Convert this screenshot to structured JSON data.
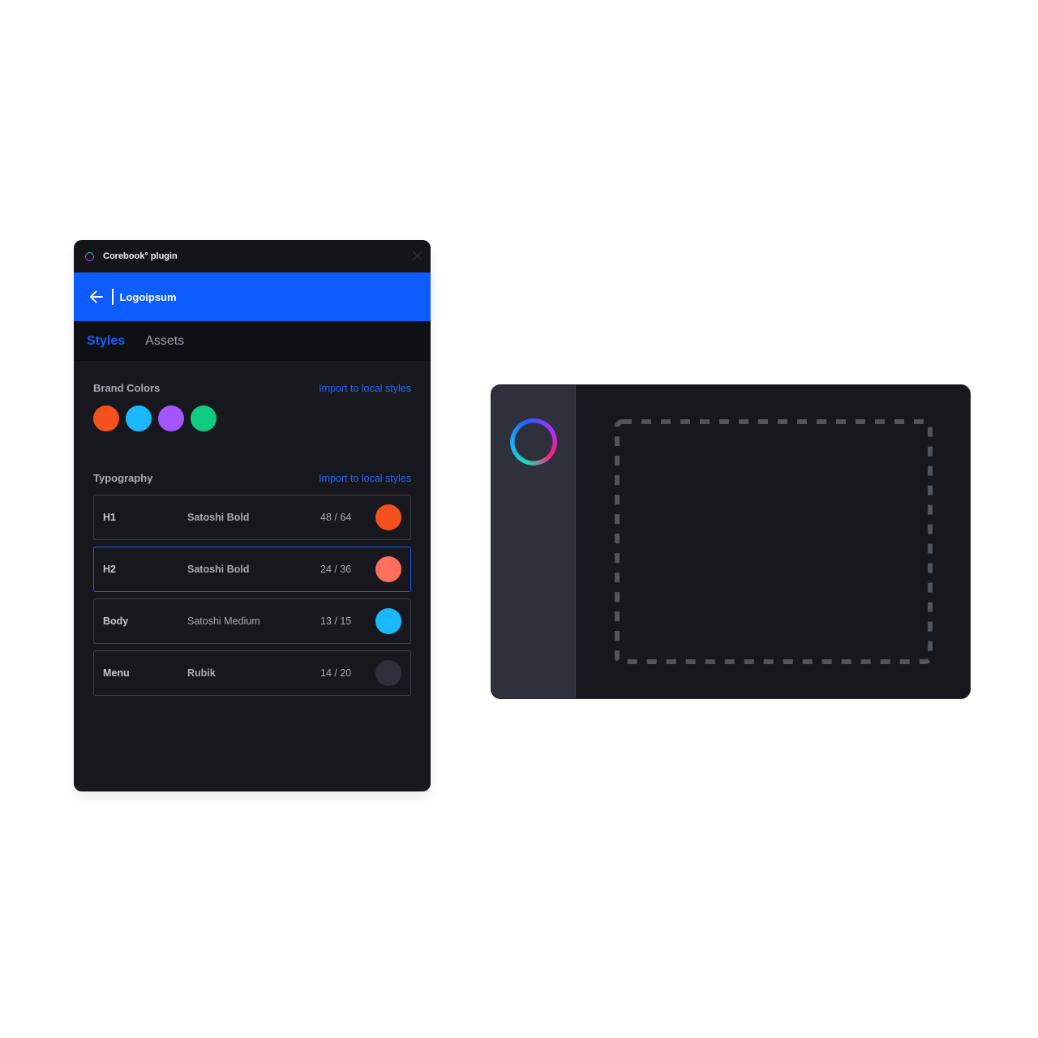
{
  "plugin": {
    "title": "Corebook° plugin",
    "header_title": "Logoipsum",
    "tabs": [
      {
        "label": "Styles",
        "active": true
      },
      {
        "label": "Assets",
        "active": false
      }
    ],
    "brand_colors": {
      "title": "Brand Colors",
      "import_label": "Import to local styles",
      "colors": [
        "#f4511e",
        "#1ab8ff",
        "#a356ff",
        "#0fcb80"
      ]
    },
    "typography": {
      "title": "Typography",
      "import_label": "Import to local styles",
      "rows": [
        {
          "name": "H1",
          "font": "Satoshi Bold",
          "size": "48 / 64",
          "color": "#f4511e",
          "selected": false
        },
        {
          "name": "H2",
          "font": "Satoshi Bold",
          "size": "24 / 36",
          "color": "#ff6f5e",
          "selected": true
        },
        {
          "name": "Body",
          "font": "Satoshi Medium",
          "size": "13 / 15",
          "color": "#1ab8ff",
          "selected": false
        },
        {
          "name": "Menu",
          "font": "Rubik",
          "size": "14 / 20",
          "color": "#2d2f3a",
          "selected": false
        }
      ]
    }
  },
  "preview": {
    "dropzone_border_color": "#4f555e"
  }
}
